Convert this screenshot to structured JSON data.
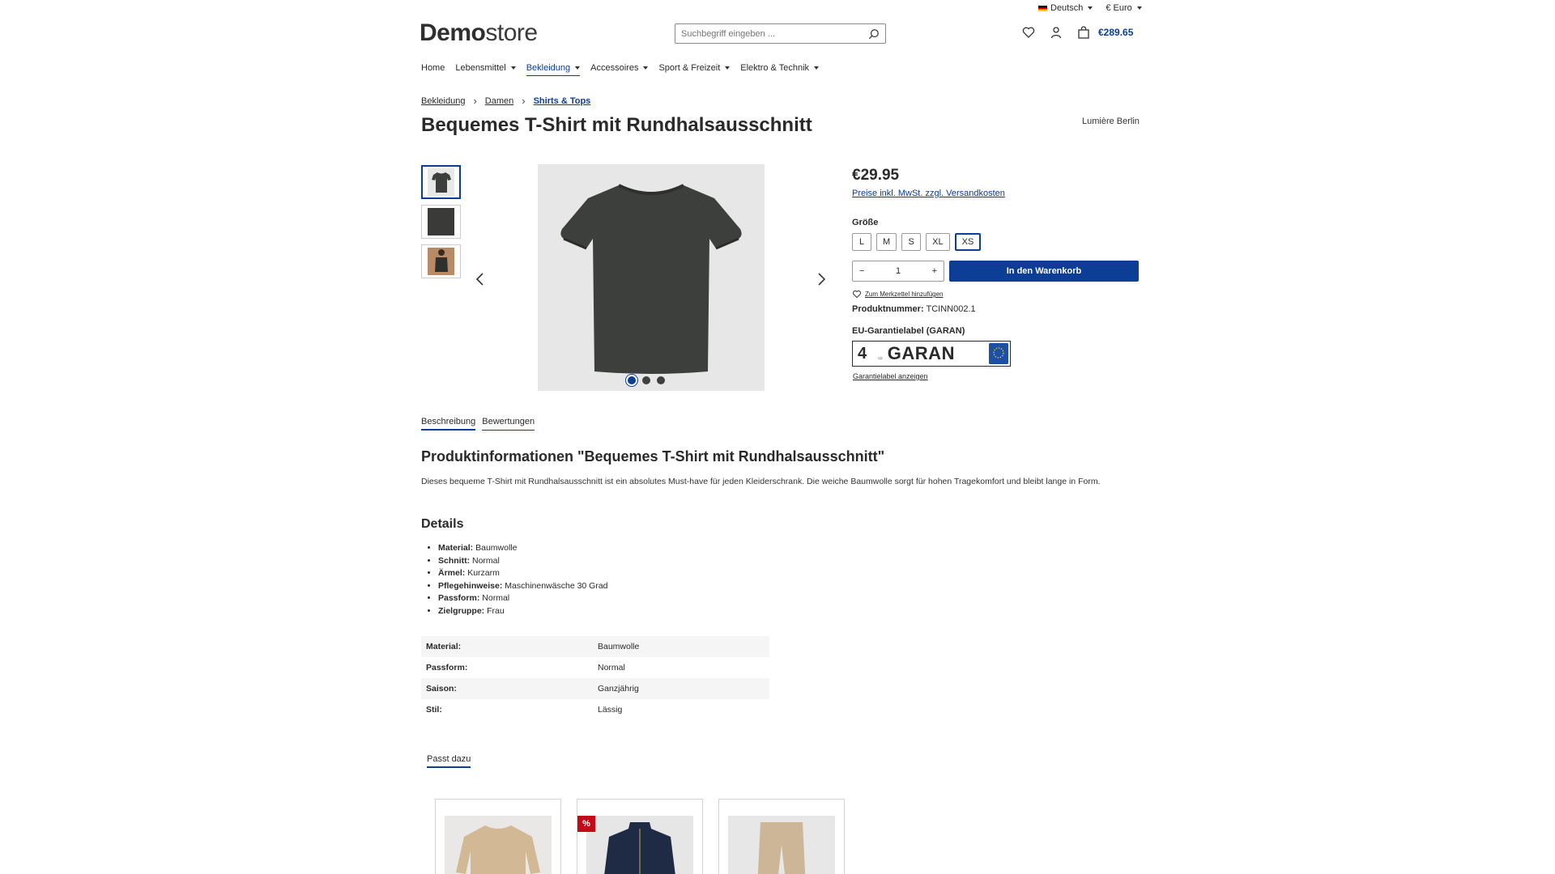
{
  "topbar": {
    "language": "Deutsch",
    "currency": "€ Euro"
  },
  "header": {
    "logo_bold": "Demo",
    "logo_light": "store",
    "search_placeholder": "Suchbegriff eingeben ...",
    "cart_total": "€289.65"
  },
  "nav": {
    "items": [
      {
        "label": "Home"
      },
      {
        "label": "Lebensmittel"
      },
      {
        "label": "Bekleidung"
      },
      {
        "label": "Accessoires"
      },
      {
        "label": "Sport & Freizeit"
      },
      {
        "label": "Elektro & Technik"
      }
    ]
  },
  "breadcrumb": [
    "Bekleidung",
    "Damen",
    "Shirts & Tops"
  ],
  "product": {
    "title": "Bequemes T-Shirt mit Rundhalsausschnitt",
    "brand": "Lumière Berlin",
    "price": "€29.95",
    "tax_note": "Preise inkl. MwSt. zzgl. Versandkosten",
    "size_label": "Größe",
    "sizes": [
      "L",
      "M",
      "S",
      "XL",
      "XS"
    ],
    "selected_size": "XS",
    "quantity": "1",
    "add_to_cart": "In den Warenkorb",
    "wishlist": "Zum Merkzettel hinzufügen",
    "product_number_label": "Produktnummer:",
    "product_number": "TCINN002.1",
    "eu_label": "EU-Garantielabel (GARAN)",
    "garan_number": "4",
    "garan_word": "GARAN",
    "garan_link": "Garantielabel anzeigen"
  },
  "colors": {
    "accent": "#0b3e94",
    "sale": "#c10b19",
    "shirt": "#3d3f3c"
  },
  "tabs": [
    {
      "label": "Beschreibung"
    },
    {
      "label": "Bewertungen"
    }
  ],
  "description": {
    "heading": "Produktinformationen \"Bequemes T-Shirt mit Rundhalsausschnitt\"",
    "text": "Dieses bequeme T-Shirt mit Rundhalsausschnitt ist ein absolutes Must-have für jeden Kleiderschrank. Die weiche Baumwolle sorgt für hohen Tragekomfort und bleibt lange in Form.",
    "details_heading": "Details",
    "details": [
      {
        "key": "Material:",
        "value": "Baumwolle"
      },
      {
        "key": "Schnitt:",
        "value": "Normal"
      },
      {
        "key": "Ärmel:",
        "value": "Kurzarm"
      },
      {
        "key": "Pflegehinweise:",
        "value": "Maschinenwäsche 30 Grad"
      },
      {
        "key": "Passform:",
        "value": "Normal"
      },
      {
        "key": "Zielgruppe:",
        "value": "Frau"
      }
    ],
    "properties": [
      {
        "key": "Material:",
        "value": "Baumwolle"
      },
      {
        "key": "Passform:",
        "value": "Normal"
      },
      {
        "key": "Saison:",
        "value": "Ganzjährig"
      },
      {
        "key": "Stil:",
        "value": "Lässig"
      }
    ]
  },
  "cross_selling": {
    "tab": "Passt dazu",
    "sale_badge": "%"
  }
}
